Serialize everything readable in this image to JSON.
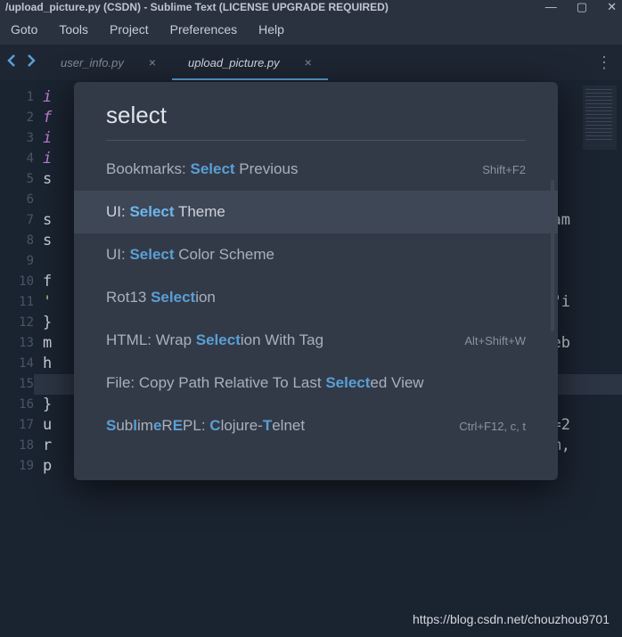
{
  "window": {
    "title": "/upload_picture.py (CSDN) - Sublime Text (LICENSE UPGRADE REQUIRED)"
  },
  "menu": {
    "items": [
      "Goto",
      "Tools",
      "Project",
      "Preferences",
      "Help"
    ]
  },
  "tabs": {
    "items": [
      {
        "label": "user_info.py",
        "active": false
      },
      {
        "label": "upload_picture.py",
        "active": true
      }
    ]
  },
  "gutter": {
    "from": 1,
    "to": 19,
    "current": 15
  },
  "code": {
    "l1": "i",
    "l2": "f",
    "l3": "i",
    "l4": "i",
    "l5": "s",
    "l7": "s",
    "l7r": "am",
    "l8": "s",
    "l10": "f",
    "l11": "'",
    "l11r": "\"i",
    "l12": "}",
    "l13": "m",
    "l13r": "eb",
    "l14": "h",
    "l16": "}",
    "l17": "u",
    "l17r": "=2",
    "l18": "r",
    "l18r": "m,",
    "l19": "p"
  },
  "palette": {
    "query": "select",
    "selected_index": 1,
    "results": [
      {
        "prefix": "Bookmarks: ",
        "match": "Select",
        "suffix": " Previous",
        "shortcut": "Shift+F2"
      },
      {
        "prefix": "UI: ",
        "match": "Select",
        "suffix": " Theme",
        "shortcut": ""
      },
      {
        "prefix": "UI: ",
        "match": "Select",
        "suffix": " Color Scheme",
        "shortcut": ""
      },
      {
        "prefix": "Rot13 ",
        "match": "Select",
        "suffix": "ion",
        "shortcut": ""
      },
      {
        "prefix": "HTML: Wrap ",
        "match": "Select",
        "suffix": "ion With Tag",
        "shortcut": "Alt+Shift+W"
      },
      {
        "prefix": "File: Copy Path Relative To Last ",
        "match": "Select",
        "suffix": "ed View",
        "shortcut": ""
      },
      {
        "html": "<span class='match'>S</span>ub<span class='match'>l</span>im<span class='match'>e</span>R<span class='match'>E</span>PL: <span class='match'>C</span>lojure-<span class='match'>T</span>elnet",
        "shortcut": "Ctrl+F12, c, t"
      }
    ]
  },
  "watermark": "https://blog.csdn.net/chouzhou9701"
}
